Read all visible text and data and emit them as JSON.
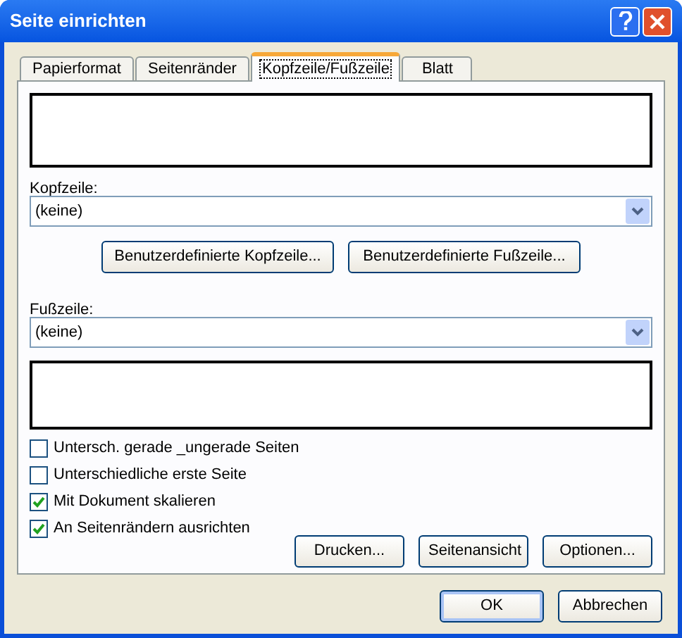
{
  "window": {
    "title": "Seite einrichten"
  },
  "tabs": [
    {
      "label": "Papierformat",
      "selected": false
    },
    {
      "label": "Seitenränder",
      "selected": false
    },
    {
      "label": "Kopfzeile/Fußzeile",
      "selected": true
    },
    {
      "label": "Blatt",
      "selected": false
    }
  ],
  "header": {
    "label": "Kopfzeile:",
    "value": "(keine)"
  },
  "custom_buttons": [
    "Benutzerdefinierte Kopfzeile...",
    "Benutzerdefinierte Fußzeile..."
  ],
  "footer": {
    "label": "Fußzeile:",
    "value": "(keine)"
  },
  "checkboxes": [
    {
      "label": "Untersch. gerade _ungerade Seiten",
      "checked": false
    },
    {
      "label": "Unterschiedliche erste Seite",
      "checked": false
    },
    {
      "label": "Mit Dokument skalieren",
      "checked": true
    },
    {
      "label": "An Seitenrändern ausrichten",
      "checked": true
    }
  ],
  "panel_buttons": [
    "Drucken...",
    "Seitenansicht",
    "Optionen..."
  ],
  "dialog_buttons": [
    {
      "label": "OK",
      "default": true
    },
    {
      "label": "Abbrechen",
      "default": false
    }
  ]
}
